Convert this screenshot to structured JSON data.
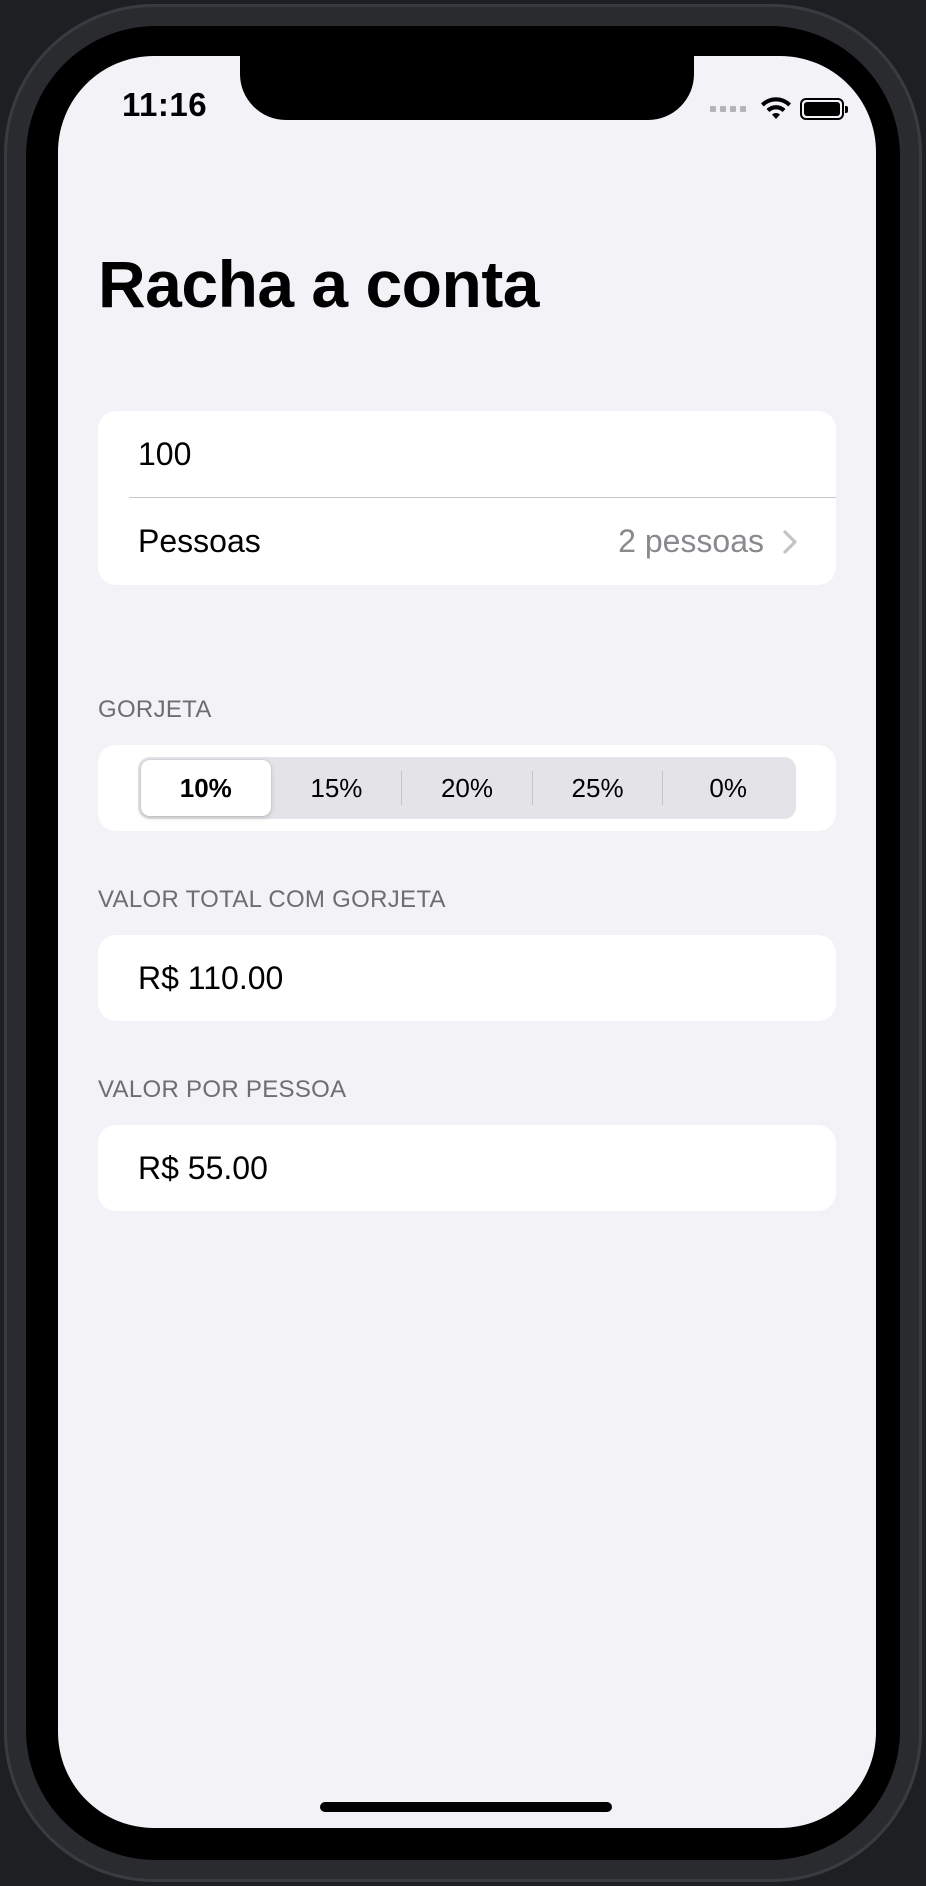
{
  "status_bar": {
    "time": "11:16",
    "icons": [
      "cellular-signal-icon",
      "wifi-icon",
      "battery-icon"
    ]
  },
  "page": {
    "title": "Racha a conta"
  },
  "form": {
    "amount_value": "100",
    "people_label": "Pessoas",
    "people_value": "2 pessoas"
  },
  "tip": {
    "header": "GORJETA",
    "options": [
      "10%",
      "15%",
      "20%",
      "25%",
      "0%"
    ],
    "selected": "10%"
  },
  "total": {
    "header": "VALOR TOTAL COM GORJETA",
    "value": "R$ 110.00"
  },
  "per_person": {
    "header": "VALOR POR PESSOA",
    "value": "R$ 55.00"
  },
  "colors": {
    "background": "#f2f2f7",
    "card": "#ffffff",
    "secondary_text": "#8a8a8e",
    "section_header": "#6d6d72",
    "segmented_track": "#e3e3e8"
  }
}
